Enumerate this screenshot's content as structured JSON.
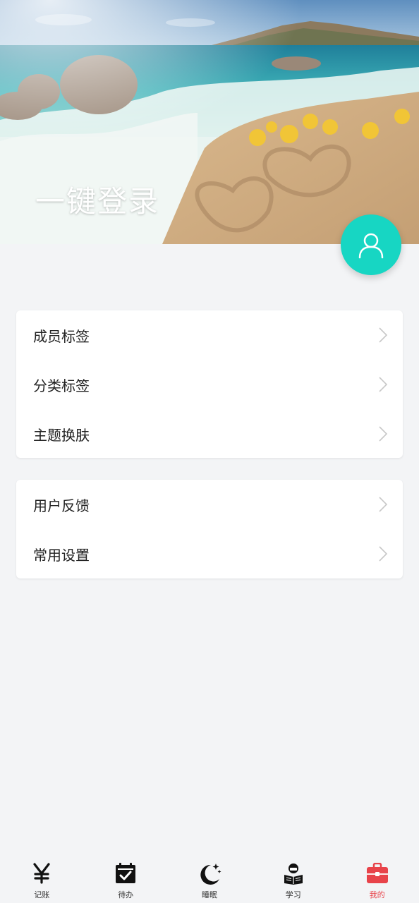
{
  "header": {
    "login_label": "一键登录"
  },
  "groups": [
    {
      "items": [
        {
          "label": "成员标签"
        },
        {
          "label": "分类标签"
        },
        {
          "label": "主题换肤"
        }
      ]
    },
    {
      "items": [
        {
          "label": "用户反馈"
        },
        {
          "label": "常用设置"
        }
      ]
    }
  ],
  "tabbar": {
    "active_index": 4,
    "tabs": [
      {
        "label": "记账",
        "icon": "yen-icon"
      },
      {
        "label": "待办",
        "icon": "calendar-check-icon"
      },
      {
        "label": "睡眠",
        "icon": "moon-stars-icon"
      },
      {
        "label": "学习",
        "icon": "reading-person-icon"
      },
      {
        "label": "我的",
        "icon": "toolbox-icon"
      }
    ]
  },
  "colors": {
    "accent": "#17d6c3",
    "active_tab": "#e8434a",
    "background": "#f3f4f6"
  }
}
